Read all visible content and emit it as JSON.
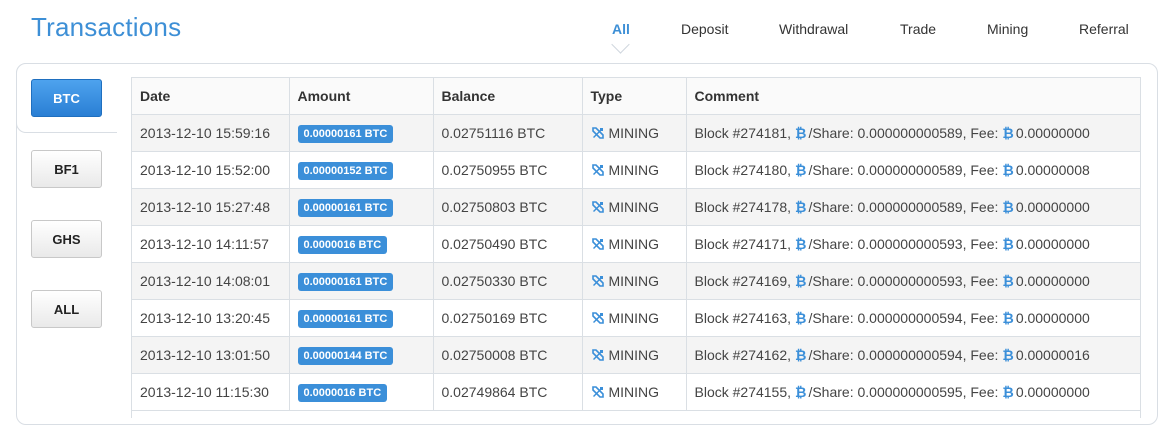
{
  "page": {
    "title": "Transactions"
  },
  "filter_tabs": [
    {
      "label": "All",
      "active": true
    },
    {
      "label": "Deposit",
      "active": false
    },
    {
      "label": "Withdrawal",
      "active": false
    },
    {
      "label": "Trade",
      "active": false
    },
    {
      "label": "Mining",
      "active": false
    },
    {
      "label": "Referral",
      "active": false
    }
  ],
  "currency_tabs": [
    {
      "label": "BTC",
      "active": true
    },
    {
      "label": "BF1",
      "active": false
    },
    {
      "label": "GHS",
      "active": false
    },
    {
      "label": "ALL",
      "active": false
    }
  ],
  "table": {
    "headers": [
      "Date",
      "Amount",
      "Balance",
      "Type",
      "Comment"
    ],
    "rows": [
      {
        "date": "2013-12-10 15:59:16",
        "amount": "0.00000161 BTC",
        "balance": "0.02751116 BTC",
        "type": "MINING",
        "block": "Block #274181,",
        "share": "/Share: 0.000000000589,",
        "fee_label": "Fee:",
        "fee": "0.00000000"
      },
      {
        "date": "2013-12-10 15:52:00",
        "amount": "0.00000152 BTC",
        "balance": "0.02750955 BTC",
        "type": "MINING",
        "block": "Block #274180,",
        "share": "/Share: 0.000000000589,",
        "fee_label": "Fee:",
        "fee": "0.00000008"
      },
      {
        "date": "2013-12-10 15:27:48",
        "amount": "0.00000161 BTC",
        "balance": "0.02750803 BTC",
        "type": "MINING",
        "block": "Block #274178,",
        "share": "/Share: 0.000000000589,",
        "fee_label": "Fee:",
        "fee": "0.00000000"
      },
      {
        "date": "2013-12-10 14:11:57",
        "amount": "0.0000016 BTC",
        "balance": "0.02750490 BTC",
        "type": "MINING",
        "block": "Block #274171,",
        "share": "/Share: 0.000000000593,",
        "fee_label": "Fee:",
        "fee": "0.00000000"
      },
      {
        "date": "2013-12-10 14:08:01",
        "amount": "0.00000161 BTC",
        "balance": "0.02750330 BTC",
        "type": "MINING",
        "block": "Block #274169,",
        "share": "/Share: 0.000000000593,",
        "fee_label": "Fee:",
        "fee": "0.00000000"
      },
      {
        "date": "2013-12-10 13:20:45",
        "amount": "0.00000161 BTC",
        "balance": "0.02750169 BTC",
        "type": "MINING",
        "block": "Block #274163,",
        "share": "/Share: 0.000000000594,",
        "fee_label": "Fee:",
        "fee": "0.00000000"
      },
      {
        "date": "2013-12-10 13:01:50",
        "amount": "0.00000144 BTC",
        "balance": "0.02750008 BTC",
        "type": "MINING",
        "block": "Block #274162,",
        "share": "/Share: 0.000000000594,",
        "fee_label": "Fee:",
        "fee": "0.00000016"
      },
      {
        "date": "2013-12-10 11:15:30",
        "amount": "0.0000016 BTC",
        "balance": "0.02749864 BTC",
        "type": "MINING",
        "block": "Block #274155,",
        "share": "/Share: 0.000000000595,",
        "fee_label": "Fee:",
        "fee": "0.00000000"
      }
    ]
  },
  "symbols": {
    "btc": "₿"
  },
  "icons": {
    "type": "mining-tools-icon",
    "currency": "bitcoin-icon"
  },
  "colors": {
    "accent": "#3b8fd9",
    "title": "#3d8fd6"
  }
}
